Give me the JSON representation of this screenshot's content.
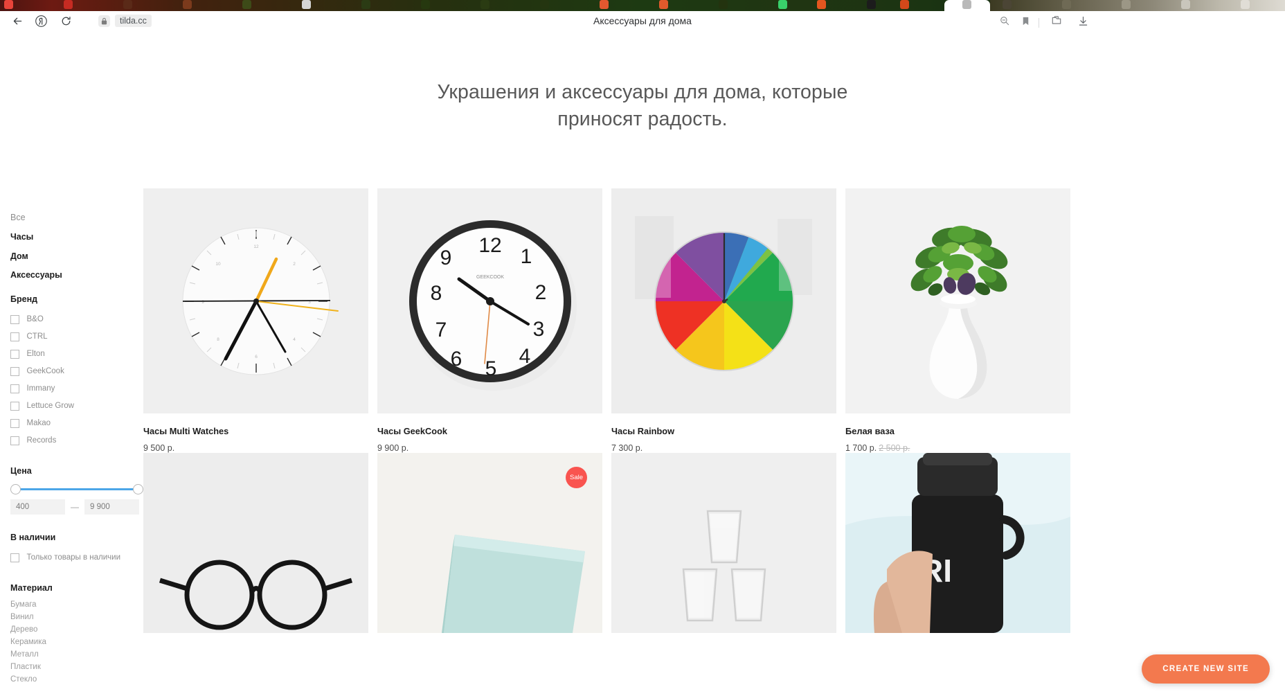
{
  "browser": {
    "tab_title": "Аксессуары для дома",
    "url": "tilda.cc",
    "back_icon": "back-arrow-icon",
    "yandex_icon": "yandex-logo-icon",
    "reload_icon": "reload-icon",
    "lock_icon": "lock-icon",
    "zoom_out_icon": "zoom-out-icon",
    "bookmark_icon": "bookmark-icon",
    "collections_icon": "collections-icon",
    "downloads_icon": "download-icon"
  },
  "hero": {
    "line1": "Украшения и аксессуары для дома, которые",
    "line2": "приносят радость."
  },
  "sidebar": {
    "categories": [
      {
        "label": "Все",
        "active": false
      },
      {
        "label": "Часы",
        "active": true
      },
      {
        "label": "Дом",
        "active": true
      },
      {
        "label": "Аксессуары",
        "active": true
      }
    ],
    "brand": {
      "title": "Бренд",
      "options": [
        {
          "label": "B&O",
          "checked": false
        },
        {
          "label": "CTRL",
          "checked": false
        },
        {
          "label": "Elton",
          "checked": false
        },
        {
          "label": "GeekCook",
          "checked": false
        },
        {
          "label": "Immany",
          "checked": false
        },
        {
          "label": "Lettuce Grow",
          "checked": false
        },
        {
          "label": "Makao",
          "checked": false
        },
        {
          "label": "Records",
          "checked": false
        }
      ]
    },
    "price": {
      "title": "Цена",
      "min_value": "400",
      "max_value": "9 900",
      "separator": "—",
      "accent_color": "#4ca6e8"
    },
    "stock": {
      "title": "В наличии",
      "option_label": "Только товары в наличии",
      "checked": false
    },
    "material": {
      "title": "Материал",
      "options": [
        "Бумага",
        "Винил",
        "Дерево",
        "Керамика",
        "Металл",
        "Пластик",
        "Стекло"
      ]
    }
  },
  "products": [
    {
      "title": "Часы Multi Watches",
      "price": "9 500 р.",
      "old_price": "",
      "sale": false
    },
    {
      "title": "Часы GeekCook",
      "price": "9 900 р.",
      "old_price": "",
      "sale": false
    },
    {
      "title": "Часы Rainbow",
      "price": "7 300 р.",
      "old_price": "",
      "sale": false
    },
    {
      "title": "Белая ваза",
      "price": "1 700 р.",
      "old_price": "2 500 р.",
      "sale": false
    },
    {
      "title": "",
      "price": "",
      "old_price": "",
      "sale": false
    },
    {
      "title": "",
      "price": "",
      "old_price": "",
      "sale": true
    },
    {
      "title": "",
      "price": "",
      "old_price": "",
      "sale": false
    },
    {
      "title": "",
      "price": "",
      "old_price": "",
      "sale": false
    }
  ],
  "badges": {
    "sale_label": "Sale",
    "sale_color": "#f9544f"
  },
  "cta": {
    "label": "CREATE NEW SITE",
    "color": "#f3794e"
  }
}
